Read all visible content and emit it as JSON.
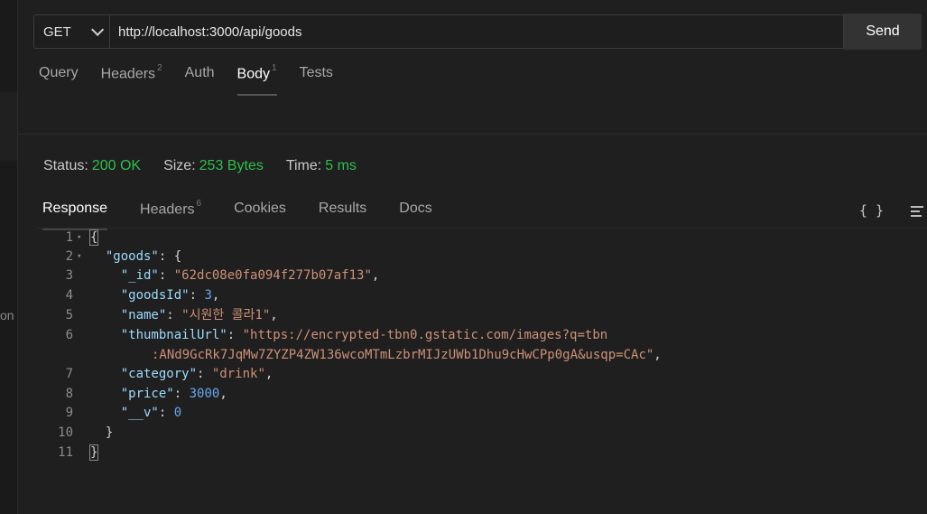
{
  "sidebar": {
    "clipped_text": "on"
  },
  "request": {
    "method": "GET",
    "url": "http://localhost:3000/api/goods",
    "send_label": "Send",
    "tabs": [
      {
        "label": "Query",
        "badge": ""
      },
      {
        "label": "Headers",
        "badge": "2"
      },
      {
        "label": "Auth",
        "badge": ""
      },
      {
        "label": "Body",
        "badge": "1"
      },
      {
        "label": "Tests",
        "badge": ""
      }
    ],
    "active_tab": "Body"
  },
  "status": {
    "status_label": "Status:",
    "status_value": "200 OK",
    "size_label": "Size:",
    "size_value": "253 Bytes",
    "time_label": "Time:",
    "time_value": "5 ms"
  },
  "response": {
    "tabs": [
      {
        "label": "Response",
        "badge": ""
      },
      {
        "label": "Headers",
        "badge": "6"
      },
      {
        "label": "Cookies",
        "badge": ""
      },
      {
        "label": "Results",
        "badge": ""
      },
      {
        "label": "Docs",
        "badge": ""
      }
    ],
    "active_tab": "Response",
    "format_icon": "{ }",
    "body": {
      "line_numbers": [
        "1",
        "2",
        "3",
        "4",
        "5",
        "6",
        "",
        "7",
        "8",
        "9",
        "10",
        "11"
      ],
      "goods_key": "\"goods\"",
      "fields": [
        {
          "key": "\"_id\"",
          "value": "\"62dc08e0fa094f277b07af13\""
        },
        {
          "key": "\"goodsId\"",
          "value": "3"
        },
        {
          "key": "\"name\"",
          "value": "\"시원한 콜라1\""
        },
        {
          "key": "\"thumbnailUrl\"",
          "value": "\"https://encrypted-tbn0.gstatic.com/images?q=tbn",
          "value_cont": ":ANd9GcRk7JqMw7ZYZP4ZW136wcoMTmLzbrMIJzUWb1Dhu9cHwCPp0gA&usqp=CAc\""
        },
        {
          "key": "\"category\"",
          "value": "\"drink\""
        },
        {
          "key": "\"price\"",
          "value": "3000"
        },
        {
          "key": "\"__v\"",
          "value": "0"
        }
      ]
    }
  },
  "colors": {
    "success": "#2fbf4b",
    "json_key": "#9cdcfe",
    "json_string": "#ce9178",
    "json_number": "#6aa6f0"
  }
}
